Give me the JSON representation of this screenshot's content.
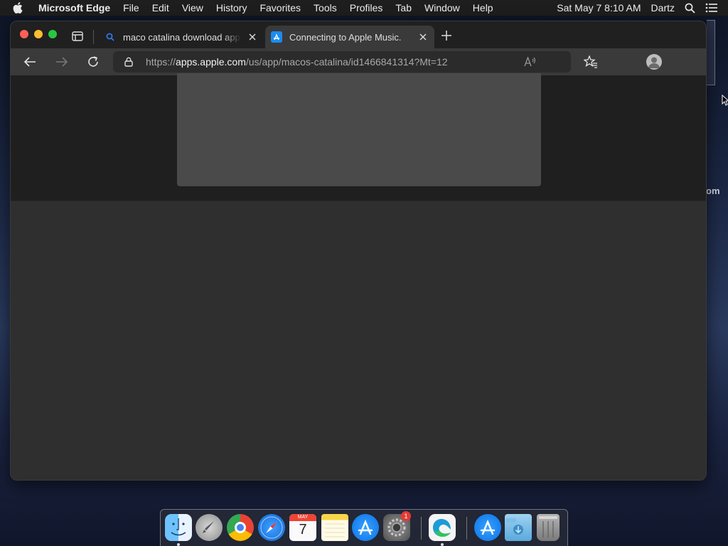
{
  "menubar": {
    "app_name": "Microsoft Edge",
    "items": [
      "File",
      "Edit",
      "View",
      "History",
      "Favorites",
      "Tools",
      "Profiles",
      "Tab",
      "Window",
      "Help"
    ],
    "clock": "Sat May 7  8:10 AM",
    "user": "Dartz"
  },
  "tabs": [
    {
      "title": "maco catalina download app store",
      "icon": "search-icon",
      "active": false
    },
    {
      "title": "Connecting to Apple Music.",
      "icon": "app-store-icon",
      "active": true
    }
  ],
  "address_bar": {
    "scheme": "https://",
    "host": "apps.apple.com",
    "path": "/us/app/macos-catalina/id1466841314?Mt=12"
  },
  "desktop": {
    "peek_text": "om"
  },
  "dock": {
    "apps": [
      "Finder",
      "Launchpad",
      "Google Chrome",
      "Safari",
      "Calendar",
      "Notes",
      "App Store",
      "System Preferences",
      "Microsoft Edge",
      "App Store",
      "Downloads",
      "Trash"
    ],
    "calendar_month": "MAY",
    "calendar_day": "7",
    "sysprefs_badge": "1"
  },
  "colors": {
    "accent": "#2f7cf6",
    "window_bg": "#2f2f2f",
    "modal_bg": "#4a4a4a"
  }
}
